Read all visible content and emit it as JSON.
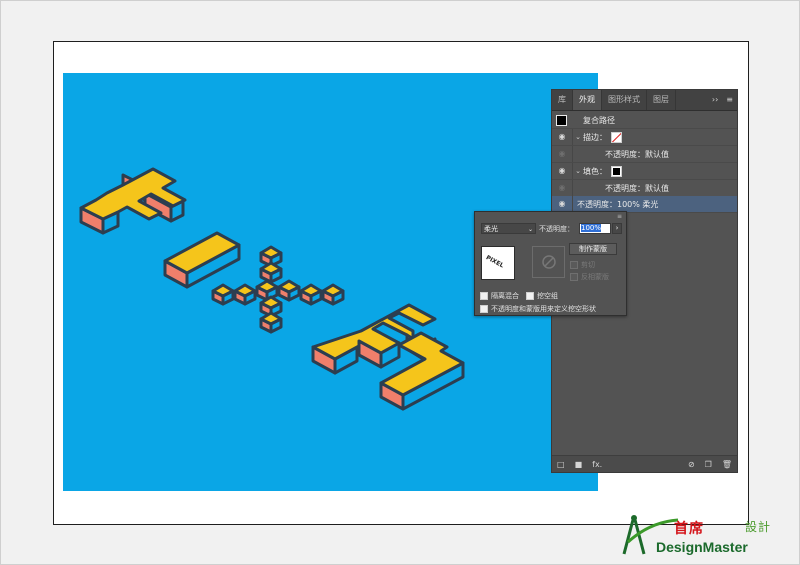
{
  "panel": {
    "tabs": [
      "库",
      "外观",
      "图形样式",
      "图层"
    ],
    "active_tab": "外观",
    "overflow": "››",
    "menu": "≡",
    "header_label": "复合路径",
    "rows": [
      {
        "kind": "stroke",
        "label": "描边："
      },
      {
        "kind": "opacity",
        "label": "不透明度：默认值"
      },
      {
        "kind": "fill",
        "label": "填色："
      },
      {
        "kind": "opacity",
        "label": "不透明度：默认值"
      },
      {
        "kind": "opacity-selected",
        "label": "不透明度：100% 柔光"
      }
    ],
    "bottom_fx": "fx."
  },
  "popup": {
    "blend_mode": "柔光",
    "opacity_label": "不透明度：",
    "opacity_value": "100%",
    "make_mask": "制作蒙版",
    "clip": "剪切",
    "invert_mask": "反相蒙版",
    "isolate_blending": "隔离混合",
    "knockout_group": "挖空组",
    "opacity_mask_define": "不透明度和蒙版用来定义挖空形状",
    "thumb_text": "PIXEL"
  },
  "logo": {
    "cn_main": "首席",
    "cn_sub": "設計",
    "en": "DesignMaster"
  },
  "colors": {
    "canvas": "#0aa6e6",
    "top_face": "#f5c51b",
    "side_face": "#f07f6b",
    "outline": "#2c3e50",
    "panel_bg": "#535353",
    "selected_row": "#4c627f"
  },
  "icons": [
    "eye-icon",
    "twirl-down-icon",
    "panel-menu-icon",
    "new-item-icon",
    "clear-icon",
    "duplicate-icon",
    "delete-icon",
    "no-mask-icon"
  ]
}
